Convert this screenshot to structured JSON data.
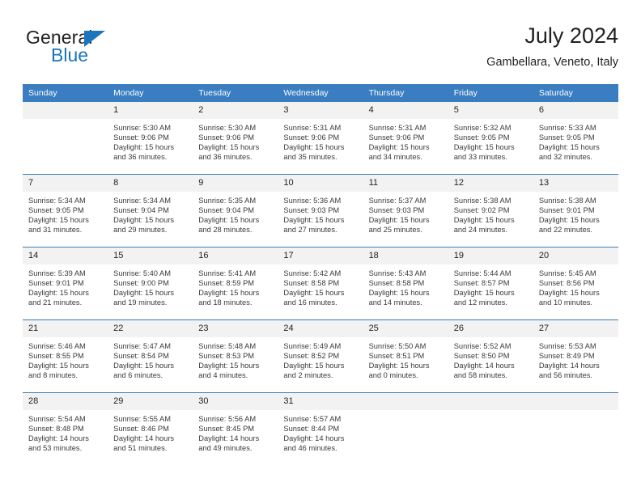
{
  "logo": {
    "word_top": "General",
    "word_bottom": "Blue",
    "triangle_color": "#1b75bb",
    "text_color": "#231f20"
  },
  "header": {
    "title": "July 2024",
    "subtitle": "Gambellara, Veneto, Italy"
  },
  "theme": {
    "header_blue": "#3a7dc0",
    "daynum_band": "#f2f2f2",
    "text": "#231f20"
  },
  "weekday_headers": [
    "Sunday",
    "Monday",
    "Tuesday",
    "Wednesday",
    "Thursday",
    "Friday",
    "Saturday"
  ],
  "weeks": [
    [
      {
        "day": "",
        "sunrise": "",
        "sunset": "",
        "daylight_1": "",
        "daylight_2": ""
      },
      {
        "day": "1",
        "sunrise": "Sunrise: 5:30 AM",
        "sunset": "Sunset: 9:06 PM",
        "daylight_1": "Daylight: 15 hours",
        "daylight_2": "and 36 minutes."
      },
      {
        "day": "2",
        "sunrise": "Sunrise: 5:30 AM",
        "sunset": "Sunset: 9:06 PM",
        "daylight_1": "Daylight: 15 hours",
        "daylight_2": "and 36 minutes."
      },
      {
        "day": "3",
        "sunrise": "Sunrise: 5:31 AM",
        "sunset": "Sunset: 9:06 PM",
        "daylight_1": "Daylight: 15 hours",
        "daylight_2": "and 35 minutes."
      },
      {
        "day": "4",
        "sunrise": "Sunrise: 5:31 AM",
        "sunset": "Sunset: 9:06 PM",
        "daylight_1": "Daylight: 15 hours",
        "daylight_2": "and 34 minutes."
      },
      {
        "day": "5",
        "sunrise": "Sunrise: 5:32 AM",
        "sunset": "Sunset: 9:05 PM",
        "daylight_1": "Daylight: 15 hours",
        "daylight_2": "and 33 minutes."
      },
      {
        "day": "6",
        "sunrise": "Sunrise: 5:33 AM",
        "sunset": "Sunset: 9:05 PM",
        "daylight_1": "Daylight: 15 hours",
        "daylight_2": "and 32 minutes."
      }
    ],
    [
      {
        "day": "7",
        "sunrise": "Sunrise: 5:34 AM",
        "sunset": "Sunset: 9:05 PM",
        "daylight_1": "Daylight: 15 hours",
        "daylight_2": "and 31 minutes."
      },
      {
        "day": "8",
        "sunrise": "Sunrise: 5:34 AM",
        "sunset": "Sunset: 9:04 PM",
        "daylight_1": "Daylight: 15 hours",
        "daylight_2": "and 29 minutes."
      },
      {
        "day": "9",
        "sunrise": "Sunrise: 5:35 AM",
        "sunset": "Sunset: 9:04 PM",
        "daylight_1": "Daylight: 15 hours",
        "daylight_2": "and 28 minutes."
      },
      {
        "day": "10",
        "sunrise": "Sunrise: 5:36 AM",
        "sunset": "Sunset: 9:03 PM",
        "daylight_1": "Daylight: 15 hours",
        "daylight_2": "and 27 minutes."
      },
      {
        "day": "11",
        "sunrise": "Sunrise: 5:37 AM",
        "sunset": "Sunset: 9:03 PM",
        "daylight_1": "Daylight: 15 hours",
        "daylight_2": "and 25 minutes."
      },
      {
        "day": "12",
        "sunrise": "Sunrise: 5:38 AM",
        "sunset": "Sunset: 9:02 PM",
        "daylight_1": "Daylight: 15 hours",
        "daylight_2": "and 24 minutes."
      },
      {
        "day": "13",
        "sunrise": "Sunrise: 5:38 AM",
        "sunset": "Sunset: 9:01 PM",
        "daylight_1": "Daylight: 15 hours",
        "daylight_2": "and 22 minutes."
      }
    ],
    [
      {
        "day": "14",
        "sunrise": "Sunrise: 5:39 AM",
        "sunset": "Sunset: 9:01 PM",
        "daylight_1": "Daylight: 15 hours",
        "daylight_2": "and 21 minutes."
      },
      {
        "day": "15",
        "sunrise": "Sunrise: 5:40 AM",
        "sunset": "Sunset: 9:00 PM",
        "daylight_1": "Daylight: 15 hours",
        "daylight_2": "and 19 minutes."
      },
      {
        "day": "16",
        "sunrise": "Sunrise: 5:41 AM",
        "sunset": "Sunset: 8:59 PM",
        "daylight_1": "Daylight: 15 hours",
        "daylight_2": "and 18 minutes."
      },
      {
        "day": "17",
        "sunrise": "Sunrise: 5:42 AM",
        "sunset": "Sunset: 8:58 PM",
        "daylight_1": "Daylight: 15 hours",
        "daylight_2": "and 16 minutes."
      },
      {
        "day": "18",
        "sunrise": "Sunrise: 5:43 AM",
        "sunset": "Sunset: 8:58 PM",
        "daylight_1": "Daylight: 15 hours",
        "daylight_2": "and 14 minutes."
      },
      {
        "day": "19",
        "sunrise": "Sunrise: 5:44 AM",
        "sunset": "Sunset: 8:57 PM",
        "daylight_1": "Daylight: 15 hours",
        "daylight_2": "and 12 minutes."
      },
      {
        "day": "20",
        "sunrise": "Sunrise: 5:45 AM",
        "sunset": "Sunset: 8:56 PM",
        "daylight_1": "Daylight: 15 hours",
        "daylight_2": "and 10 minutes."
      }
    ],
    [
      {
        "day": "21",
        "sunrise": "Sunrise: 5:46 AM",
        "sunset": "Sunset: 8:55 PM",
        "daylight_1": "Daylight: 15 hours",
        "daylight_2": "and 8 minutes."
      },
      {
        "day": "22",
        "sunrise": "Sunrise: 5:47 AM",
        "sunset": "Sunset: 8:54 PM",
        "daylight_1": "Daylight: 15 hours",
        "daylight_2": "and 6 minutes."
      },
      {
        "day": "23",
        "sunrise": "Sunrise: 5:48 AM",
        "sunset": "Sunset: 8:53 PM",
        "daylight_1": "Daylight: 15 hours",
        "daylight_2": "and 4 minutes."
      },
      {
        "day": "24",
        "sunrise": "Sunrise: 5:49 AM",
        "sunset": "Sunset: 8:52 PM",
        "daylight_1": "Daylight: 15 hours",
        "daylight_2": "and 2 minutes."
      },
      {
        "day": "25",
        "sunrise": "Sunrise: 5:50 AM",
        "sunset": "Sunset: 8:51 PM",
        "daylight_1": "Daylight: 15 hours",
        "daylight_2": "and 0 minutes."
      },
      {
        "day": "26",
        "sunrise": "Sunrise: 5:52 AM",
        "sunset": "Sunset: 8:50 PM",
        "daylight_1": "Daylight: 14 hours",
        "daylight_2": "and 58 minutes."
      },
      {
        "day": "27",
        "sunrise": "Sunrise: 5:53 AM",
        "sunset": "Sunset: 8:49 PM",
        "daylight_1": "Daylight: 14 hours",
        "daylight_2": "and 56 minutes."
      }
    ],
    [
      {
        "day": "28",
        "sunrise": "Sunrise: 5:54 AM",
        "sunset": "Sunset: 8:48 PM",
        "daylight_1": "Daylight: 14 hours",
        "daylight_2": "and 53 minutes."
      },
      {
        "day": "29",
        "sunrise": "Sunrise: 5:55 AM",
        "sunset": "Sunset: 8:46 PM",
        "daylight_1": "Daylight: 14 hours",
        "daylight_2": "and 51 minutes."
      },
      {
        "day": "30",
        "sunrise": "Sunrise: 5:56 AM",
        "sunset": "Sunset: 8:45 PM",
        "daylight_1": "Daylight: 14 hours",
        "daylight_2": "and 49 minutes."
      },
      {
        "day": "31",
        "sunrise": "Sunrise: 5:57 AM",
        "sunset": "Sunset: 8:44 PM",
        "daylight_1": "Daylight: 14 hours",
        "daylight_2": "and 46 minutes."
      },
      {
        "day": "",
        "sunrise": "",
        "sunset": "",
        "daylight_1": "",
        "daylight_2": ""
      },
      {
        "day": "",
        "sunrise": "",
        "sunset": "",
        "daylight_1": "",
        "daylight_2": ""
      },
      {
        "day": "",
        "sunrise": "",
        "sunset": "",
        "daylight_1": "",
        "daylight_2": ""
      }
    ]
  ]
}
